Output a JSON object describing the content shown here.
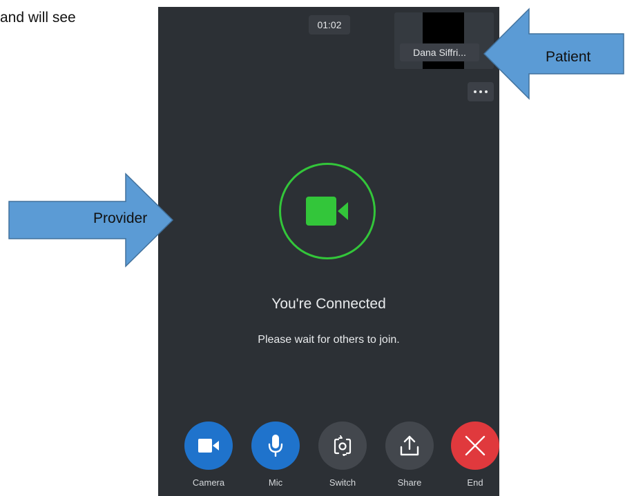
{
  "document": {
    "top_text": "and will see"
  },
  "call": {
    "timer": "01:02",
    "participant_name": "Dana Siffri...",
    "status_title": "You're Connected",
    "status_subtitle": "Please wait for others to join."
  },
  "controls": [
    {
      "label": "Camera",
      "icon": "video-camera-icon",
      "color": "#1f73cc"
    },
    {
      "label": "Mic",
      "icon": "microphone-icon",
      "color": "#1f73cc"
    },
    {
      "label": "Switch",
      "icon": "switch-camera-icon",
      "color": "#43474d"
    },
    {
      "label": "Share",
      "icon": "share-upload-icon",
      "color": "#43474d"
    },
    {
      "label": "End",
      "icon": "close-x-icon",
      "color": "#e0393d"
    }
  ],
  "annotations": {
    "patient_label": "Patient",
    "provider_label": "Provider",
    "arrow_color": "#5b9bd5"
  },
  "colors": {
    "background": "#2c3035",
    "connected_green": "#33c63a"
  }
}
